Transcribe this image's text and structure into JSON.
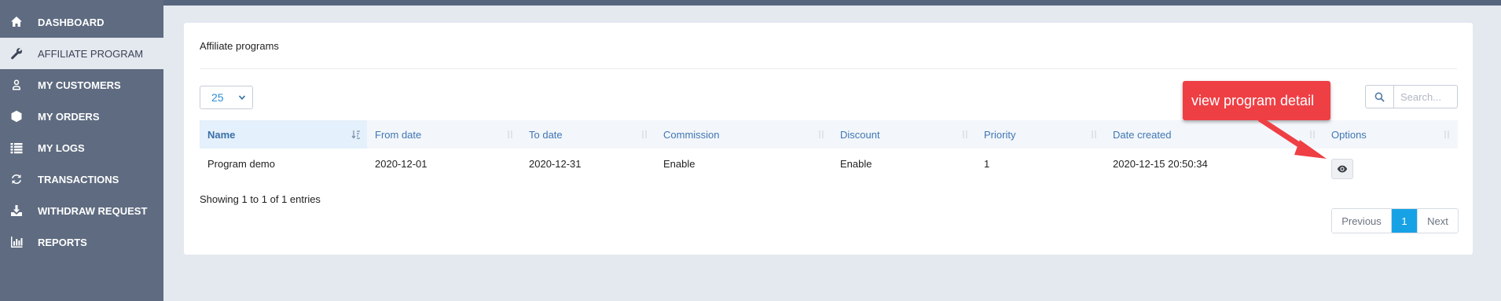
{
  "sidebar": {
    "items": [
      {
        "label": "DASHBOARD",
        "icon": "home-icon",
        "active": false
      },
      {
        "label": "AFFILIATE PROGRAM",
        "icon": "wrench-icon",
        "active": true
      },
      {
        "label": "MY CUSTOMERS",
        "icon": "user-icon",
        "active": false
      },
      {
        "label": "MY ORDERS",
        "icon": "box-icon",
        "active": false
      },
      {
        "label": "MY LOGS",
        "icon": "list-icon",
        "active": false
      },
      {
        "label": "TRANSACTIONS",
        "icon": "refresh-icon",
        "active": false
      },
      {
        "label": "WITHDRAW REQUEST",
        "icon": "download-icon",
        "active": false
      },
      {
        "label": "REPORTS",
        "icon": "bar-chart-icon",
        "active": false
      }
    ]
  },
  "panel": {
    "title": "Affiliate programs",
    "page_length": "25",
    "search_placeholder": "Search..."
  },
  "table": {
    "columns": [
      "Name",
      "From date",
      "To date",
      "Commission",
      "Discount",
      "Priority",
      "Date created",
      "Options"
    ],
    "sorted_column": "Name",
    "rows": [
      {
        "name": "Program demo",
        "from_date": "2020-12-01",
        "to_date": "2020-12-31",
        "commission": "Enable",
        "discount": "Enable",
        "priority": "1",
        "date_created": "2020-12-15 20:50:34",
        "option_icon": "eye-icon"
      }
    ]
  },
  "footer": {
    "info": "Showing 1 to 1 of 1 entries",
    "previous_label": "Previous",
    "current_page": "1",
    "next_label": "Next"
  },
  "annotation": {
    "text": "view program detail"
  },
  "colors": {
    "sidebar_bg": "#5e6b80",
    "accent_blue": "#18a2e6",
    "callout_red": "#ee3f45",
    "header_link": "#3f77b5"
  }
}
